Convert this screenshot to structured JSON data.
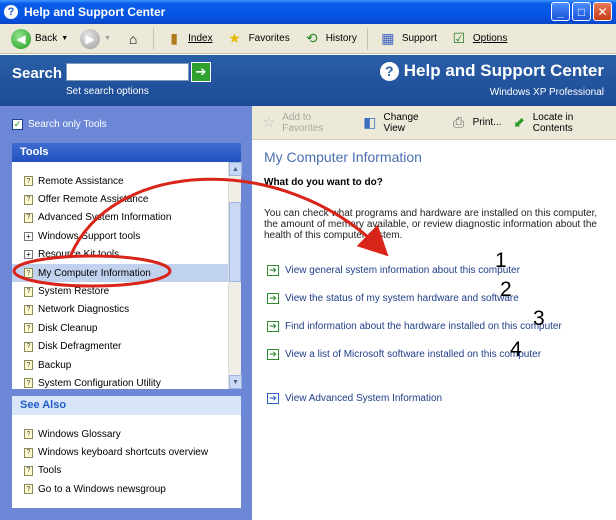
{
  "window": {
    "title": "Help and Support Center",
    "buttons": {
      "minimize": "_",
      "maximize": "□",
      "close": "✕"
    }
  },
  "toolbar": {
    "back": "Back",
    "index": "Index",
    "favorites": "Favorites",
    "history": "History",
    "support": "Support",
    "options": "Options"
  },
  "header": {
    "search_label": "Search",
    "search_value": "",
    "set_search_options": "Set search options",
    "title": "Help and Support Center",
    "subtitle": "Windows XP Professional"
  },
  "sidebar": {
    "search_only_tools": "Search only Tools",
    "tools_heading": "Tools",
    "tools": [
      {
        "label": "Remote Assistance",
        "kind": "page"
      },
      {
        "label": "Offer Remote Assistance",
        "kind": "page"
      },
      {
        "label": "Advanced System Information",
        "kind": "page"
      },
      {
        "label": "Windows Support tools",
        "kind": "plus"
      },
      {
        "label": "Resource Kit tools",
        "kind": "plus"
      },
      {
        "label": "My Computer Information",
        "kind": "page",
        "selected": true
      },
      {
        "label": "System Restore",
        "kind": "page"
      },
      {
        "label": "Network Diagnostics",
        "kind": "page"
      },
      {
        "label": "Disk Cleanup",
        "kind": "page"
      },
      {
        "label": "Disk Defragmenter",
        "kind": "page"
      },
      {
        "label": "Backup",
        "kind": "page"
      },
      {
        "label": "System Configuration Utility",
        "kind": "page"
      }
    ],
    "see_also_heading": "See Also",
    "see_also": [
      "Windows Glossary",
      "Windows keyboard shortcuts overview",
      "Tools",
      "Go to a Windows newsgroup"
    ]
  },
  "content_toolbar": {
    "add_to_favorites": "Add to Favorites",
    "change_view": "Change View",
    "print": "Print...",
    "locate_in_contents": "Locate in Contents"
  },
  "content": {
    "title": "My Computer Information",
    "question": "What do you want to do?",
    "intro": "You can check what programs and hardware are installed on this computer, the amount of memory available, or review diagnostic information about the health of this computer system.",
    "tasks": [
      "View general system information about this computer",
      "View the status of my system hardware and software",
      "Find information about the hardware installed on this computer",
      "View a list of Microsoft software installed on this computer"
    ],
    "advanced_task": "View Advanced System Information",
    "annotation_numbers": [
      "1",
      "2",
      "3",
      "4"
    ]
  },
  "annotation_color": "#d9241a"
}
